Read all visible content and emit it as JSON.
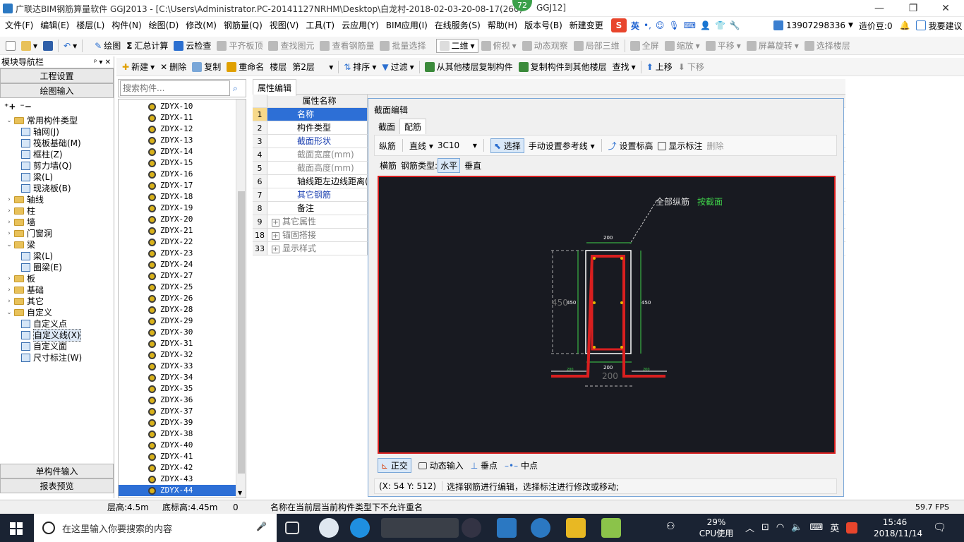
{
  "window": {
    "title": "广联达BIM钢筋算量软件 GGJ2013 - [C:\\Users\\Administrator.PC-20141127NRHM\\Desktop\\白龙村-2018-02-03-20-08-17(260)",
    "title_tail": "GGJ12]",
    "badge": "72"
  },
  "menu": [
    "文件(F)",
    "编辑(E)",
    "楼层(L)",
    "构件(N)",
    "绘图(D)",
    "修改(M)",
    "钢筋量(Q)",
    "视图(V)",
    "工具(T)",
    "云应用(Y)",
    "BIM应用(I)",
    "在线服务(S)",
    "帮助(H)",
    "版本号(B)",
    "新建变更"
  ],
  "account": {
    "phone": "13907298336",
    "price": "造价豆:0",
    "suggest": "我要建议",
    "ime": "英"
  },
  "toolbar1": {
    "draw": "绘图",
    "sum": "汇总计算",
    "cloud_check": "云检查",
    "flat_slab": "平齐板顶",
    "find_elem": "查找图元",
    "view_rebar": "查看钢筋量",
    "batch_select": "批量选择",
    "view_mode": "二维",
    "top_view": "俯视",
    "dynamic": "动态观察",
    "local3d": "局部三维",
    "fullscreen": "全屏",
    "zoom": "缩放",
    "pan": "平移",
    "rotate": "屏幕旋转",
    "floor_select": "选择楼层"
  },
  "toolbar2": {
    "new": "新建",
    "delete": "删除",
    "copy": "复制",
    "rename": "重命名",
    "floor_label": "楼层",
    "floor_value": "第2层",
    "sort": "排序",
    "filter": "过滤",
    "copy_from": "从其他楼层复制构件",
    "copy_to": "复制构件到其他楼层",
    "find": "查找",
    "up": "上移",
    "down": "下移"
  },
  "leftpanel": {
    "header": "模块导航栏",
    "proj_settings": "工程设置",
    "draw_input": "绘图输入",
    "single_input": "单构件输入",
    "report": "报表预览",
    "tree": [
      {
        "label": "常用构件类型",
        "level": 0,
        "type": "folder",
        "open": true
      },
      {
        "label": "轴网(J)",
        "level": 1,
        "type": "leaf"
      },
      {
        "label": "筏板基础(M)",
        "level": 1,
        "type": "leaf"
      },
      {
        "label": "框柱(Z)",
        "level": 1,
        "type": "leaf"
      },
      {
        "label": "剪力墙(Q)",
        "level": 1,
        "type": "leaf"
      },
      {
        "label": "梁(L)",
        "level": 1,
        "type": "leaf"
      },
      {
        "label": "现浇板(B)",
        "level": 1,
        "type": "leaf"
      },
      {
        "label": "轴线",
        "level": 0,
        "type": "folder",
        "open": false
      },
      {
        "label": "柱",
        "level": 0,
        "type": "folder",
        "open": false
      },
      {
        "label": "墙",
        "level": 0,
        "type": "folder",
        "open": false
      },
      {
        "label": "门窗洞",
        "level": 0,
        "type": "folder",
        "open": false
      },
      {
        "label": "梁",
        "level": 0,
        "type": "folder",
        "open": true
      },
      {
        "label": "梁(L)",
        "level": 1,
        "type": "leaf"
      },
      {
        "label": "圈梁(E)",
        "level": 1,
        "type": "leaf"
      },
      {
        "label": "板",
        "level": 0,
        "type": "folder",
        "open": false
      },
      {
        "label": "基础",
        "level": 0,
        "type": "folder",
        "open": false
      },
      {
        "label": "其它",
        "level": 0,
        "type": "folder",
        "open": false
      },
      {
        "label": "自定义",
        "level": 0,
        "type": "folder",
        "open": true
      },
      {
        "label": "自定义点",
        "level": 1,
        "type": "leaf"
      },
      {
        "label": "自定义线(X)",
        "level": 1,
        "type": "leaf",
        "selected": true
      },
      {
        "label": "自定义面",
        "level": 1,
        "type": "leaf"
      },
      {
        "label": "尺寸标注(W)",
        "level": 1,
        "type": "leaf"
      }
    ]
  },
  "components": {
    "search_placeholder": "搜索构件...",
    "items": [
      "ZDYX-10",
      "ZDYX-11",
      "ZDYX-12",
      "ZDYX-13",
      "ZDYX-14",
      "ZDYX-15",
      "ZDYX-16",
      "ZDYX-17",
      "ZDYX-18",
      "ZDYX-19",
      "ZDYX-20",
      "ZDYX-21",
      "ZDYX-22",
      "ZDYX-23",
      "ZDYX-24",
      "ZDYX-27",
      "ZDYX-25",
      "ZDYX-26",
      "ZDYX-28",
      "ZDYX-29",
      "ZDYX-30",
      "ZDYX-31",
      "ZDYX-32",
      "ZDYX-33",
      "ZDYX-34",
      "ZDYX-35",
      "ZDYX-36",
      "ZDYX-37",
      "ZDYX-39",
      "ZDYX-38",
      "ZDYX-40",
      "ZDYX-41",
      "ZDYX-42",
      "ZDYX-43",
      "ZDYX-44"
    ],
    "selected": "ZDYX-44"
  },
  "props": {
    "tab": "属性编辑",
    "header_name": "属性名称",
    "rows": [
      {
        "num": "1",
        "name": "名称",
        "style": "selected"
      },
      {
        "num": "2",
        "name": "构件类型",
        "style": "normal"
      },
      {
        "num": "3",
        "name": "截面形状",
        "style": "blue"
      },
      {
        "num": "4",
        "name": "截面宽度(mm)",
        "style": "gray"
      },
      {
        "num": "5",
        "name": "截面高度(mm)",
        "style": "gray"
      },
      {
        "num": "6",
        "name": "轴线距左边线距离(mm)",
        "style": "normal"
      },
      {
        "num": "7",
        "name": "其它钢筋",
        "style": "blue"
      },
      {
        "num": "8",
        "name": "备注",
        "style": "normal"
      },
      {
        "num": "9",
        "name": "其它属性",
        "style": "group"
      },
      {
        "num": "18",
        "name": "锚固搭接",
        "style": "group"
      },
      {
        "num": "33",
        "name": "显示样式",
        "style": "group"
      }
    ]
  },
  "dialog": {
    "title": "截面编辑",
    "tab_section": "截面",
    "tab_rebar": "配筋",
    "longit_label": "纵筋",
    "line_mode": "直线",
    "rebar_spec": "3C10",
    "select_btn": "选择",
    "manual_ref": "手动设置参考线",
    "set_elev": "设置标高",
    "show_dim": "显示标注",
    "delete": "删除",
    "transverse": "横筋",
    "rebar_type_label": "钢筋类型:",
    "horizontal": "水平",
    "vertical": "垂直",
    "annot_all": "全部纵筋",
    "annot_section": "按截面",
    "dims": {
      "top": "200",
      "left": "450",
      "left_inner": "450",
      "right": "450",
      "bottom": "200",
      "bottom_big": "200",
      "foot_l": "200",
      "foot_r": "200"
    },
    "ortho": "正交",
    "dyn_input": "动态输入",
    "perp": "垂点",
    "midpoint": "中点",
    "coords": "(X: 54 Y: 512)",
    "hint": "选择钢筋进行编辑，选择标注进行修改或移动;"
  },
  "status": {
    "floor_h": "层高:4.5m",
    "base_elev": "底标高:4.45m",
    "zero": "0",
    "message": "名称在当前层当前构件类型下不允许重名",
    "fps": "59.7 FPS"
  },
  "taskbar": {
    "search_placeholder": "在这里输入你要搜索的内容",
    "cpu_pct": "29%",
    "cpu_label": "CPU使用",
    "ime": "英",
    "time": "15:46",
    "date": "2018/11/14"
  },
  "colors": {
    "accent": "#2d6fd6",
    "canvas_bg": "#181a21",
    "rebar_red": "#d91f1f",
    "dim_green": "#3fd24a"
  }
}
